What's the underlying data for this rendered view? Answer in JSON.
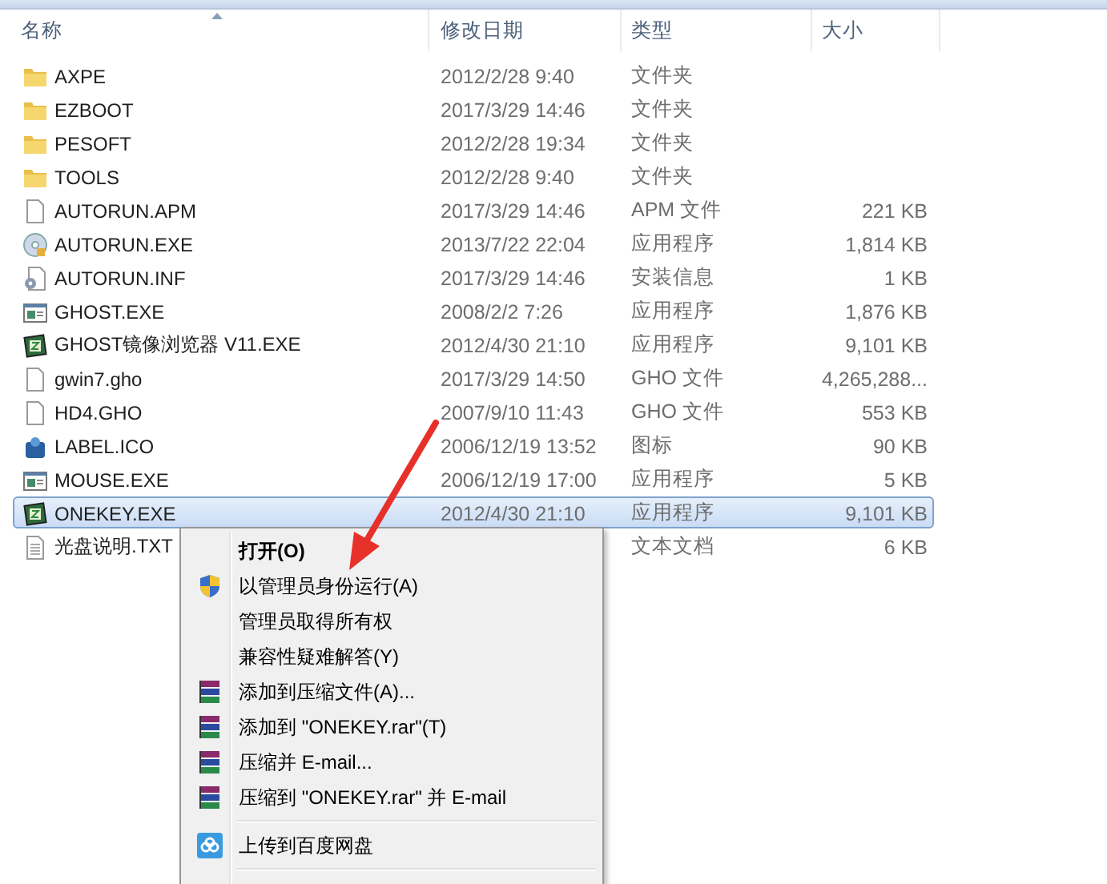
{
  "columns": [
    "名称",
    "修改日期",
    "类型",
    "大小"
  ],
  "files": [
    {
      "kind": "folder",
      "name": "AXPE",
      "date": "2012/2/28 9:40",
      "type": "文件夹",
      "selected": false
    },
    {
      "kind": "folder",
      "name": "EZBOOT",
      "date": "2017/3/29 14:46",
      "type": "文件夹",
      "selected": false
    },
    {
      "kind": "folder",
      "name": "PESOFT",
      "date": "2012/2/28 19:34",
      "type": "文件夹",
      "selected": false
    },
    {
      "kind": "folder",
      "name": "TOOLS",
      "date": "2012/2/28 9:40",
      "type": "文件夹",
      "selected": false
    },
    {
      "kind": "doc",
      "name": "AUTORUN.APM",
      "date": "2017/3/29 14:46",
      "type": "APM 文件",
      "size": "221 KB",
      "selected": false
    },
    {
      "kind": "disc",
      "name": "AUTORUN.EXE",
      "date": "2013/7/22 22:04",
      "type": "应用程序",
      "size": "1,814 KB",
      "selected": false
    },
    {
      "kind": "setup",
      "name": "AUTORUN.INF",
      "date": "2017/3/29 14:46",
      "type": "安装信息",
      "size": "1 KB",
      "selected": false
    },
    {
      "kind": "app",
      "name": "GHOST.EXE",
      "date": "2008/2/2 7:26",
      "type": "应用程序",
      "size": "1,876 KB",
      "selected": false
    },
    {
      "kind": "ghost",
      "name": "GHOST镜像浏览器 V11.EXE",
      "date": "2012/4/30 21:10",
      "type": "应用程序",
      "size": "9,101 KB",
      "selected": false
    },
    {
      "kind": "doc",
      "name": "gwin7.gho",
      "date": "2017/3/29 14:50",
      "type": "GHO 文件",
      "size": "4,265,288...",
      "selected": false
    },
    {
      "kind": "doc",
      "name": "HD4.GHO",
      "date": "2007/9/10 11:43",
      "type": "GHO 文件",
      "size": "553 KB",
      "selected": false
    },
    {
      "kind": "icon",
      "name": "LABEL.ICO",
      "date": "2006/12/19 13:52",
      "type": "图标",
      "size": "90 KB",
      "selected": false
    },
    {
      "kind": "app",
      "name": "MOUSE.EXE",
      "date": "2006/12/19 17:00",
      "type": "应用程序",
      "size": "5 KB",
      "selected": false
    },
    {
      "kind": "ghost",
      "name": "ONEKEY.EXE",
      "date": "2012/4/30 21:10",
      "type": "应用程序",
      "size": "9,101 KB",
      "selected": true
    },
    {
      "kind": "text",
      "name": "光盘说明.TXT",
      "type": "文本文档",
      "size": "6 KB",
      "selected": false
    }
  ],
  "context_menu": [
    {
      "kind": "default",
      "label": "打开(O)"
    },
    {
      "kind": "admin",
      "label": "以管理员身份运行(A)"
    },
    {
      "kind": "plain",
      "label": "管理员取得所有权"
    },
    {
      "kind": "plain",
      "label": "兼容性疑难解答(Y)"
    },
    {
      "kind": "archive",
      "label": "添加到压缩文件(A)..."
    },
    {
      "kind": "archive",
      "label": "添加到 \"ONEKEY.rar\"(T)"
    },
    {
      "kind": "archive",
      "label": "压缩并 E-mail..."
    },
    {
      "kind": "archive",
      "label": "压缩到 \"ONEKEY.rar\" 并 E-mail"
    },
    {
      "kind": "separator"
    },
    {
      "kind": "cloud",
      "label": "上传到百度网盘"
    },
    {
      "kind": "separator"
    }
  ]
}
